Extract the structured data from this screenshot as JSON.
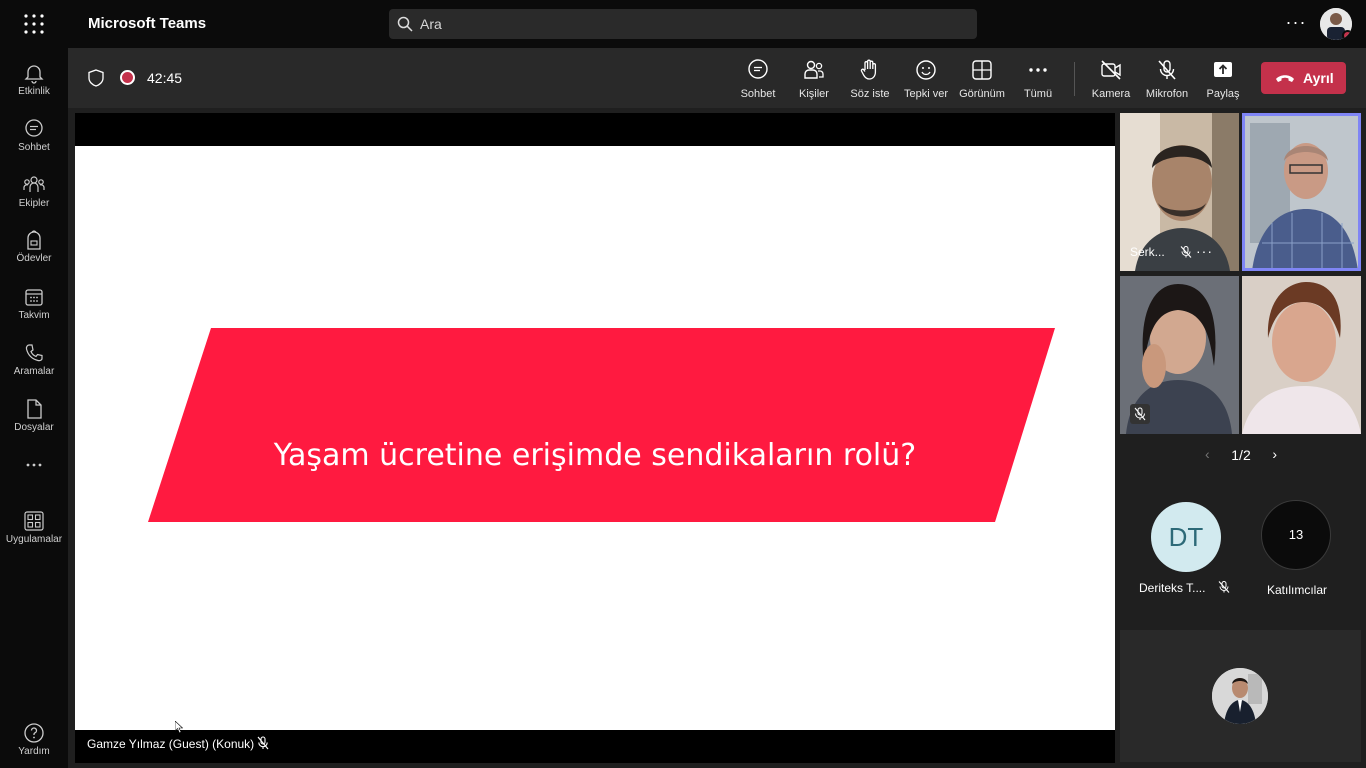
{
  "app": {
    "title": "Microsoft Teams"
  },
  "search": {
    "placeholder": "Ara"
  },
  "rail": {
    "items": [
      {
        "label": "Etkinlik",
        "icon": "bell-icon"
      },
      {
        "label": "Sohbet",
        "icon": "chat-icon"
      },
      {
        "label": "Ekipler",
        "icon": "teams-icon"
      },
      {
        "label": "Ödevler",
        "icon": "assignments-icon"
      },
      {
        "label": "Takvim",
        "icon": "calendar-icon"
      },
      {
        "label": "Aramalar",
        "icon": "phone-icon"
      },
      {
        "label": "Dosyalar",
        "icon": "file-icon"
      },
      {
        "label": "Uygulamalar",
        "icon": "apps-icon"
      },
      {
        "label": "Yardım",
        "icon": "help-icon"
      }
    ]
  },
  "call": {
    "timer": "42:45",
    "controls": {
      "chat": "Sohbet",
      "people": "Kişiler",
      "raise_hand": "Söz iste",
      "react": "Tepki ver",
      "view": "Görünüm",
      "more": "Tümü",
      "camera": "Kamera",
      "mic": "Mikrofon",
      "share": "Paylaş",
      "leave": "Ayrıl"
    },
    "accent": "#c4314b"
  },
  "stage": {
    "slide_title": "Yaşam ücretine erişimde sendikaların rolü?",
    "slide_shape_color": "#ff1a40",
    "presenter": "Gamze Yılmaz (Guest) (Konuk)"
  },
  "participants": {
    "tiles": [
      {
        "name": "Serk...",
        "muted": true
      },
      {
        "name": "",
        "muted": false,
        "selected": true
      },
      {
        "name": "",
        "muted": true
      },
      {
        "name": "",
        "muted": false
      }
    ],
    "pager": {
      "page": "1/2"
    },
    "overflow": {
      "initials": "DT",
      "name": "Deriteks T....",
      "muted": true
    },
    "count": {
      "value": "13",
      "label": "Katılımcılar"
    }
  }
}
